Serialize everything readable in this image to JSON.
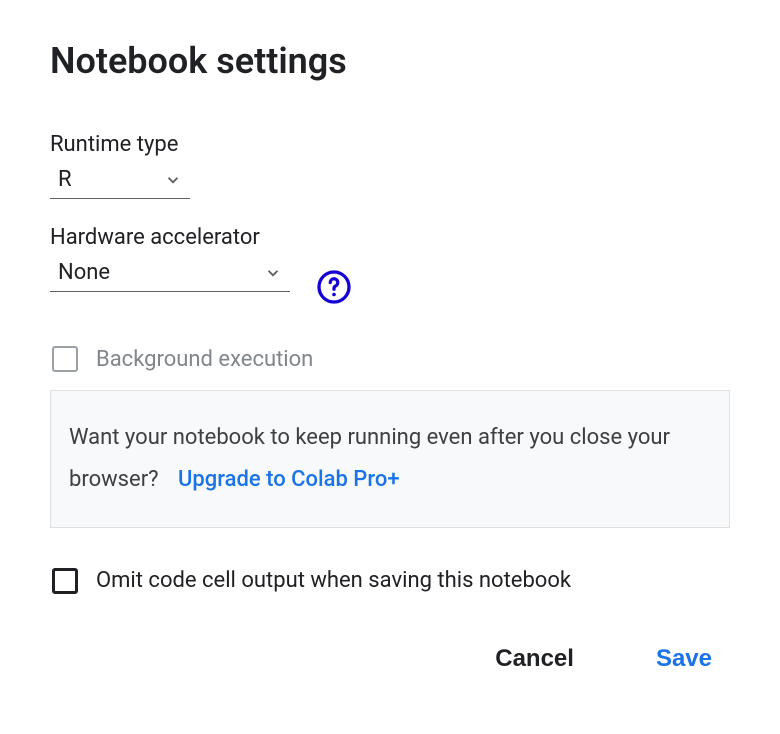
{
  "title": "Notebook settings",
  "runtime": {
    "label": "Runtime type",
    "value": "R"
  },
  "accelerator": {
    "label": "Hardware accelerator",
    "value": "None"
  },
  "background_execution": {
    "label": "Background execution",
    "checked": false,
    "disabled": true
  },
  "upsell": {
    "text": "Want your notebook to keep running even after you close your browser?",
    "link_text": "Upgrade to Colab Pro+"
  },
  "omit_output": {
    "label": "Omit code cell output when saving this notebook",
    "checked": false
  },
  "actions": {
    "cancel": "Cancel",
    "save": "Save"
  }
}
